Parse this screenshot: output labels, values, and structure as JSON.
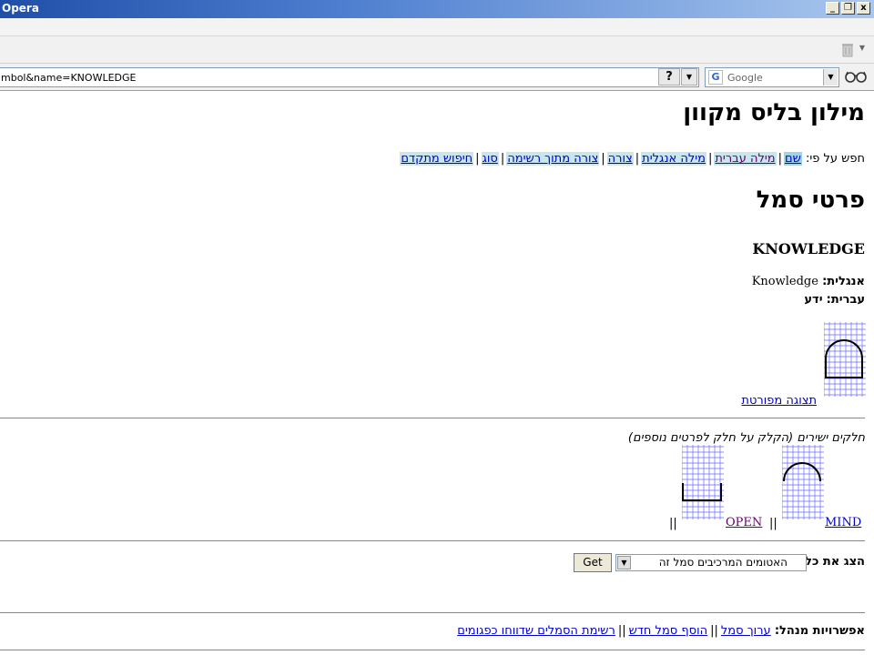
{
  "window": {
    "title": "Opera",
    "buttons": {
      "minimize": "_",
      "restore": "❐",
      "close": "x"
    }
  },
  "address_bar": {
    "url": "mbol&name=KNOWLEDGE",
    "help_label": "?",
    "search_placeholder": "Google"
  },
  "page": {
    "site_title": "מילון בליס מקוון",
    "search_by_label": "חפש על פי:",
    "search_links": [
      {
        "label": "שם"
      },
      {
        "label": "מילה עברית"
      },
      {
        "label": "מילה אנגלית"
      },
      {
        "label": "צורה"
      },
      {
        "label": "צורה מתוך רשימה"
      },
      {
        "label": "סוג"
      },
      {
        "label": "חיפוש מתקדם"
      }
    ],
    "symbol_title": "פרטי סמל",
    "symbol_name": "KNOWLEDGE",
    "english_label": "אנגלית:",
    "english_value": "Knowledge",
    "hebrew_label": "עברית:",
    "hebrew_value": "ידע",
    "detail_link": "תצוגה מפורטת",
    "parts_note": "חלקים ישירים (הקלק על חלק לפרטים נוספים)",
    "parts": [
      {
        "label": "MIND"
      },
      {
        "label": "OPEN"
      }
    ],
    "part_separator": "||",
    "show_all_label": "הצג את כל:",
    "show_select_value": "האטומים המרכיבים סמל זה",
    "get_button": "Get",
    "admin_label": "אפשרויות מנהל:",
    "admin_links": [
      {
        "label": "ערוך סמל"
      },
      {
        "label": "הוסף סמל חדש"
      },
      {
        "label": "רשימת הסמלים שדווחו כפגומים"
      }
    ],
    "admin_separator": "||"
  },
  "colors": {
    "link": "#0000cc",
    "visited": "#660066",
    "highlight": "#9fd4e6",
    "grid_line": "#6a6aff"
  }
}
